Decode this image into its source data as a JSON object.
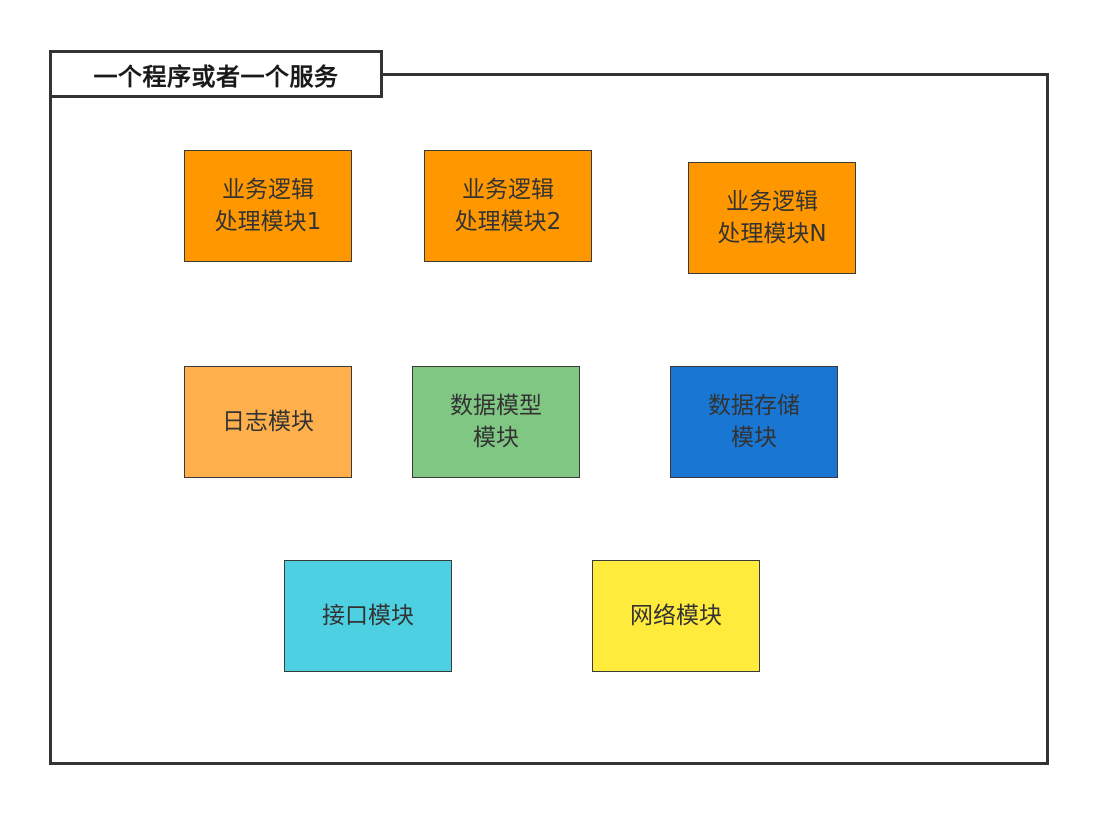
{
  "container": {
    "title": "一个程序或者一个服务"
  },
  "modules": [
    {
      "id": "m1",
      "lines": [
        "业务逻辑",
        "处理模块1"
      ],
      "color": "#FF9800",
      "text_color": "#333333"
    },
    {
      "id": "m2",
      "lines": [
        "业务逻辑",
        "处理模块2"
      ],
      "color": "#FF9800",
      "text_color": "#333333"
    },
    {
      "id": "m3",
      "lines": [
        "业务逻辑",
        "处理模块N"
      ],
      "color": "#FF9800",
      "text_color": "#333333"
    },
    {
      "id": "m4",
      "lines": [
        "日志模块"
      ],
      "color": "#FFB04C",
      "text_color": "#333333"
    },
    {
      "id": "m5",
      "lines": [
        "数据模型",
        "模块"
      ],
      "color": "#81C784",
      "text_color": "#333333"
    },
    {
      "id": "m6",
      "lines": [
        "数据存储",
        "模块"
      ],
      "color": "#1976D2",
      "text_color": "#333333"
    },
    {
      "id": "m7",
      "lines": [
        "接口模块"
      ],
      "color": "#4DD0E1",
      "text_color": "#333333"
    },
    {
      "id": "m8",
      "lines": [
        "网络模块"
      ],
      "color": "#FFEB3B",
      "text_color": "#333333"
    }
  ]
}
